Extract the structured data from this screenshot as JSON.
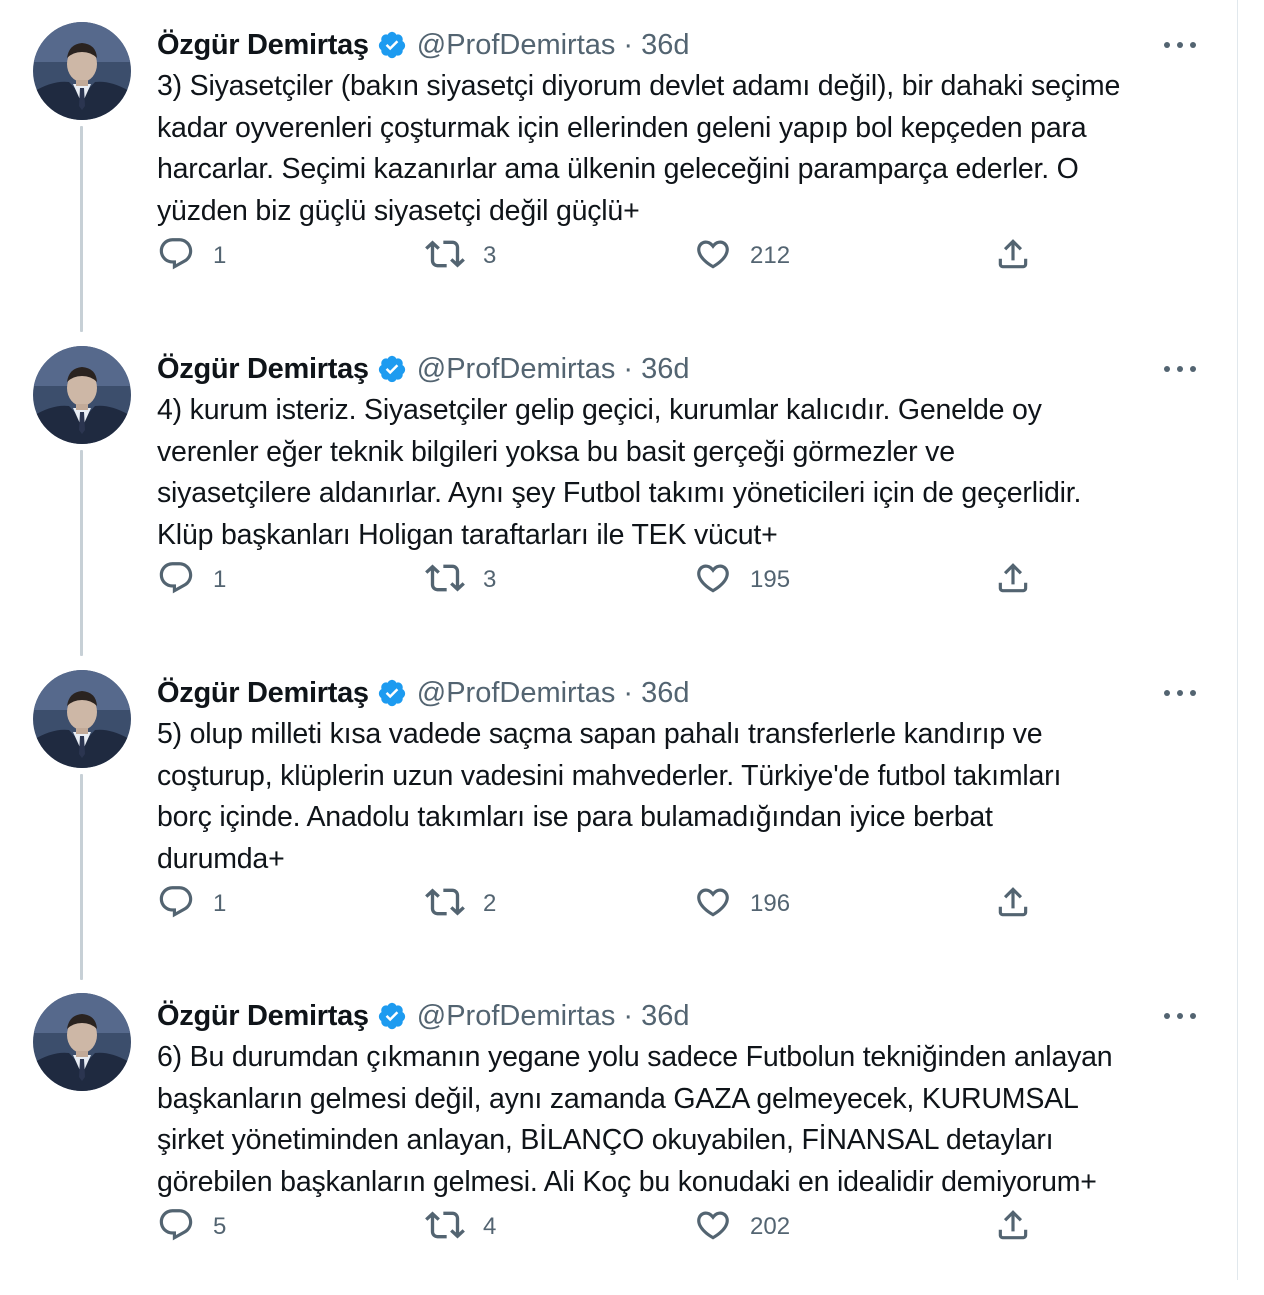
{
  "tweets": [
    {
      "name": "Özgür Demirtaş",
      "handle": "@ProfDemirtas",
      "separator": "·",
      "time": "36d",
      "text_lines": [
        "3) Siyasetçiler (bakın siyasetçi diyorum devlet adamı değil), bir dahaki seçime",
        "kadar oyverenleri çoşturmak için ellerinden geleni yapıp bol kepçeden para",
        "harcarlar. Seçimi kazanırlar ama ülkenin geleceğini paramparça ederler. O",
        "yüzden biz güçlü siyasetçi değil güçlü+"
      ],
      "replies": "1",
      "retweets": "3",
      "likes": "212"
    },
    {
      "name": "Özgür Demirtaş",
      "handle": "@ProfDemirtas",
      "separator": "·",
      "time": "36d",
      "text_lines": [
        "4) kurum isteriz. Siyasetçiler gelip geçici, kurumlar kalıcıdır. Genelde oy",
        "verenler eğer teknik bilgileri yoksa bu basit gerçeği görmezler ve",
        "siyasetçilere aldanırlar. Aynı şey Futbol takımı yöneticileri için de geçerlidir.",
        "Klüp başkanları Holigan taraftarları ile TEK vücut+"
      ],
      "replies": "1",
      "retweets": "3",
      "likes": "195"
    },
    {
      "name": "Özgür Demirtaş",
      "handle": "@ProfDemirtas",
      "separator": "·",
      "time": "36d",
      "text_lines": [
        "5) olup milleti kısa vadede saçma sapan pahalı transferlerle kandırıp ve",
        "coşturup, klüplerin uzun vadesini mahvederler. Türkiye'de futbol takımları",
        "borç içinde. Anadolu takımları ise para bulamadığından iyice berbat",
        "durumda+"
      ],
      "replies": "1",
      "retweets": "2",
      "likes": "196"
    },
    {
      "name": "Özgür Demirtaş",
      "handle": "@ProfDemirtas",
      "separator": "·",
      "time": "36d",
      "text_lines": [
        "6) Bu durumdan çıkmanın yegane yolu sadece Futbolun tekniğinden anlayan",
        "başkanların gelmesi değil, aynı zamanda GAZA gelmeyecek, KURUMSAL",
        "şirket yönetiminden anlayan, BİLANÇO okuyabilen, FİNANSAL detayları",
        "görebilen başkanların gelmesi. Ali Koç bu konudaki en idealidir demiyorum+"
      ],
      "replies": "5",
      "retweets": "4",
      "likes": "202"
    }
  ],
  "colors": {
    "verified": "#1d9bf0",
    "secondary_text": "#536471",
    "thread_line": "#c7d0d6",
    "icon": "#536471"
  },
  "icons": {
    "reply": "reply-icon",
    "retweet": "retweet-icon",
    "like": "heart-icon",
    "share": "share-icon",
    "more": "more-icon",
    "verified": "verified-badge-icon"
  }
}
